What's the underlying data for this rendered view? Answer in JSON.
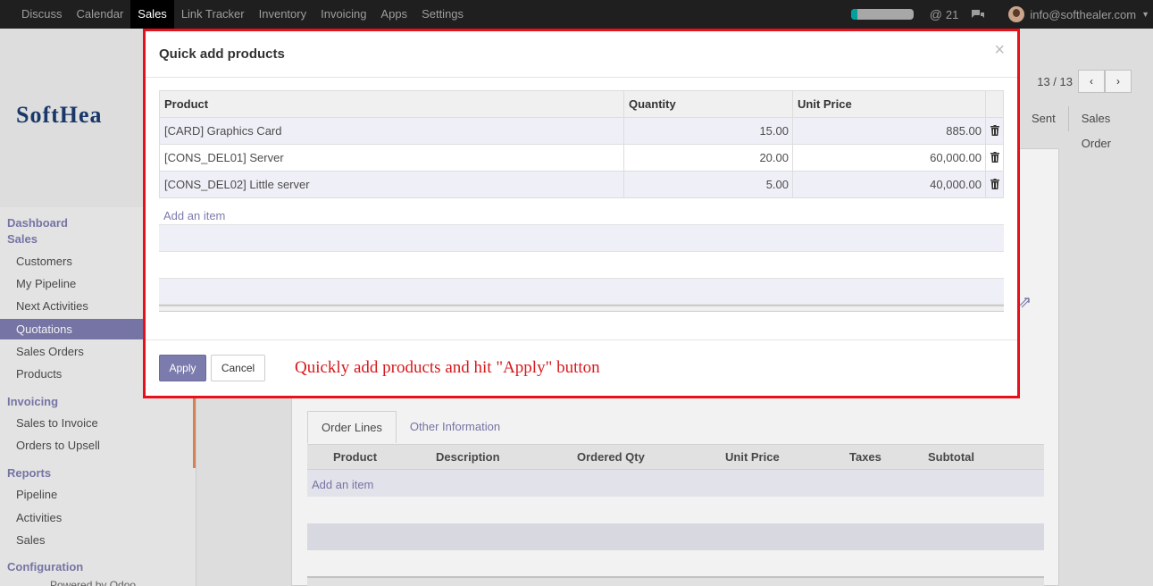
{
  "topbar": {
    "menu": [
      "Discuss",
      "Calendar",
      "Sales",
      "Link Tracker",
      "Inventory",
      "Invoicing",
      "Apps",
      "Settings"
    ],
    "active_menu": "Sales",
    "activity_progress": 0.1,
    "mention_count": "21",
    "user_email": "info@softhealer.com"
  },
  "background": {
    "logo_text": "SoftHea",
    "pager": {
      "value": "13 / 13",
      "prev": "‹",
      "next": "›"
    },
    "status": [
      "Sent",
      "Sales Order"
    ],
    "sidebar": {
      "sections": [
        "Dashboard",
        "Sales",
        "Invoicing",
        "Reports",
        "Configuration"
      ],
      "items": [
        "Customers",
        "My Pipeline",
        "Next Activities",
        "Quotations",
        "Sales Orders",
        "Products",
        "Sales to Invoice",
        "Orders to Upsell",
        "Pipeline",
        "Activities",
        "Sales"
      ],
      "selected": "Quotations",
      "powered": "Powered by Odoo"
    },
    "tabs": [
      "Order Lines",
      "Other Information"
    ],
    "order_lines_columns": [
      "Product",
      "Description",
      "Ordered Qty",
      "Unit Price",
      "Taxes",
      "Subtotal"
    ],
    "order_lines_add": "Add an item"
  },
  "modal": {
    "title": "Quick add products",
    "close": "×",
    "columns": [
      "Product",
      "Quantity",
      "Unit Price"
    ],
    "rows": [
      {
        "product": "[CARD] Graphics Card",
        "quantity": "15.00",
        "unit_price": "885.00"
      },
      {
        "product": "[CONS_DEL01] Server",
        "quantity": "20.00",
        "unit_price": "60,000.00"
      },
      {
        "product": "[CONS_DEL02] Little server",
        "quantity": "5.00",
        "unit_price": "40,000.00"
      }
    ],
    "add_item": "Add an item",
    "apply_label": "Apply",
    "cancel_label": "Cancel",
    "annotation": "Quickly add products and hit \"Apply\" button"
  },
  "colors": {
    "accent": "#7c7bad",
    "highlight_border": "#e8101a",
    "annotation": "#d7191c"
  }
}
